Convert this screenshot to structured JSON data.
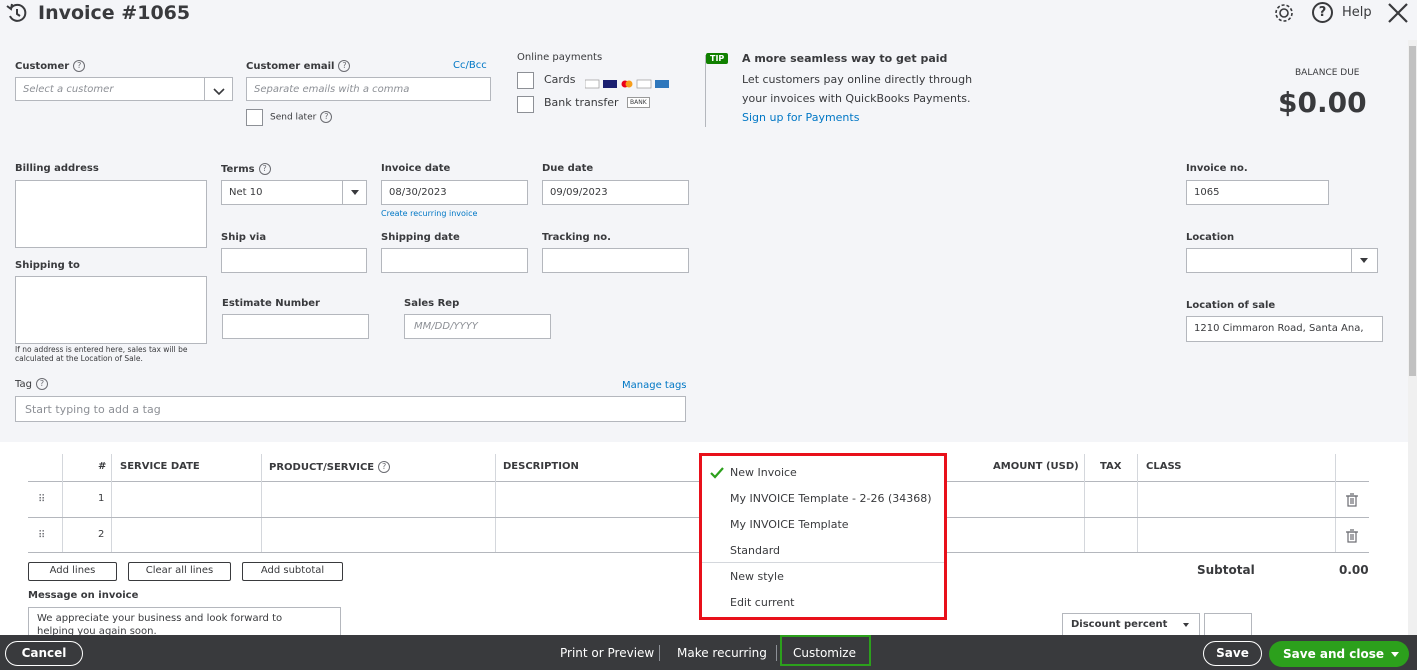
{
  "header": {
    "title": "Invoice #1065",
    "help_label": "Help"
  },
  "customer": {
    "label": "Customer",
    "placeholder": "Select a customer"
  },
  "customer_email": {
    "label": "Customer email",
    "placeholder": "Separate emails with a comma",
    "cc_bcc": "Cc/Bcc",
    "send_later": "Send later"
  },
  "online_payments": {
    "title": "Online payments",
    "cards": "Cards",
    "bank_transfer": "Bank transfer",
    "bank_badge": "BANK"
  },
  "tip": {
    "badge": "TIP",
    "title": "A more seamless way to get paid",
    "line1": "Let customers pay online directly through",
    "line2": "your invoices with QuickBooks Payments.",
    "link": "Sign up for Payments"
  },
  "balance": {
    "label": "BALANCE DUE",
    "amount": "$0.00"
  },
  "billing": {
    "billing_label": "Billing address",
    "shipping_label": "Shipping to",
    "note_line1": "If no address is entered here, sales tax will be",
    "note_line2": "calculated at the Location of Sale."
  },
  "terms": {
    "label": "Terms",
    "value": "Net 10"
  },
  "invoice_date": {
    "label": "Invoice date",
    "value": "08/30/2023",
    "recurring_link": "Create recurring invoice"
  },
  "due_date": {
    "label": "Due date",
    "value": "09/09/2023"
  },
  "ship_via": {
    "label": "Ship via"
  },
  "shipping_date": {
    "label": "Shipping date"
  },
  "tracking": {
    "label": "Tracking no."
  },
  "estimate_number": {
    "label": "Estimate Number"
  },
  "sales_rep": {
    "label": "Sales Rep",
    "placeholder": "MM/DD/YYYY"
  },
  "invoice_no": {
    "label": "Invoice no.",
    "value": "1065"
  },
  "location": {
    "label": "Location"
  },
  "location_of_sale": {
    "label": "Location of sale",
    "value": "1210 Cimmaron Road, Santa Ana,"
  },
  "tags": {
    "label": "Tag",
    "manage": "Manage tags",
    "placeholder": "Start typing to add a tag"
  },
  "table": {
    "headers": {
      "num": "#",
      "service_date": "SERVICE DATE",
      "product": "PRODUCT/SERVICE",
      "description": "DESCRIPTION",
      "amount": "AMOUNT (USD)",
      "tax": "TAX",
      "class": "CLASS"
    },
    "rows": [
      {
        "num": "1"
      },
      {
        "num": "2"
      }
    ]
  },
  "line_buttons": {
    "add_lines": "Add lines",
    "clear_all": "Clear all lines",
    "add_subtotal": "Add subtotal"
  },
  "subtotal": {
    "label": "Subtotal",
    "value": "0.00"
  },
  "message": {
    "label": "Message on invoice",
    "line1": "We appreciate your business and look forward to",
    "line2": "helping you again soon."
  },
  "discount": {
    "label": "Discount percent"
  },
  "customize_menu": {
    "items": [
      "New Invoice",
      "My INVOICE Template - 2-26 (34368)",
      "My INVOICE Template",
      "Standard",
      "New style",
      "Edit current"
    ]
  },
  "footer": {
    "cancel": "Cancel",
    "print_preview": "Print or Preview",
    "make_recurring": "Make recurring",
    "customize": "Customize",
    "save": "Save",
    "save_close": "Save and close"
  },
  "colors": {
    "accent_green": "#2ca01c",
    "link_blue": "#0077c5",
    "highlight_red": "#e8101a",
    "footer_dark": "#393a3d"
  }
}
